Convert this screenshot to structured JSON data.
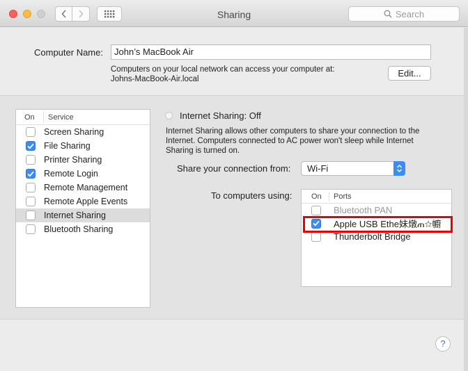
{
  "window": {
    "title": "Sharing",
    "search_placeholder": "Search"
  },
  "computer_name": {
    "label": "Computer Name:",
    "value": "John’s MacBook Air",
    "info_line1": "Computers on your local network can access your computer at:",
    "info_line2": "Johns-MacBook-Air.local",
    "edit_label": "Edit..."
  },
  "services": {
    "col_on": "On",
    "col_service": "Service",
    "items": [
      {
        "label": "Screen Sharing",
        "checked": false
      },
      {
        "label": "File Sharing",
        "checked": true
      },
      {
        "label": "Printer Sharing",
        "checked": false
      },
      {
        "label": "Remote Login",
        "checked": true
      },
      {
        "label": "Remote Management",
        "checked": false
      },
      {
        "label": "Remote Apple Events",
        "checked": false
      },
      {
        "label": "Internet Sharing",
        "checked": false,
        "selected": true
      },
      {
        "label": "Bluetooth Sharing",
        "checked": false
      }
    ]
  },
  "internet_sharing": {
    "title": "Internet Sharing: Off",
    "description": "Internet Sharing allows other computers to share your connection to the Internet. Computers connected to AC power won't sleep while Internet Sharing is turned on.",
    "share_from_label": "Share your connection from:",
    "share_from_value": "Wi-Fi",
    "to_computers_label": "To computers using:",
    "ports_col_on": "On",
    "ports_col_ports": "Ports",
    "ports": [
      {
        "label": "Bluetooth PAN",
        "checked": false
      },
      {
        "label": "Apple USB Ethe妹燉ጠ☆幮",
        "checked": true
      },
      {
        "label": "Thunderbolt Bridge",
        "checked": false
      }
    ]
  },
  "help_label": "?",
  "colors": {
    "accent": "#3b8cf4",
    "highlight": "#e00000"
  }
}
